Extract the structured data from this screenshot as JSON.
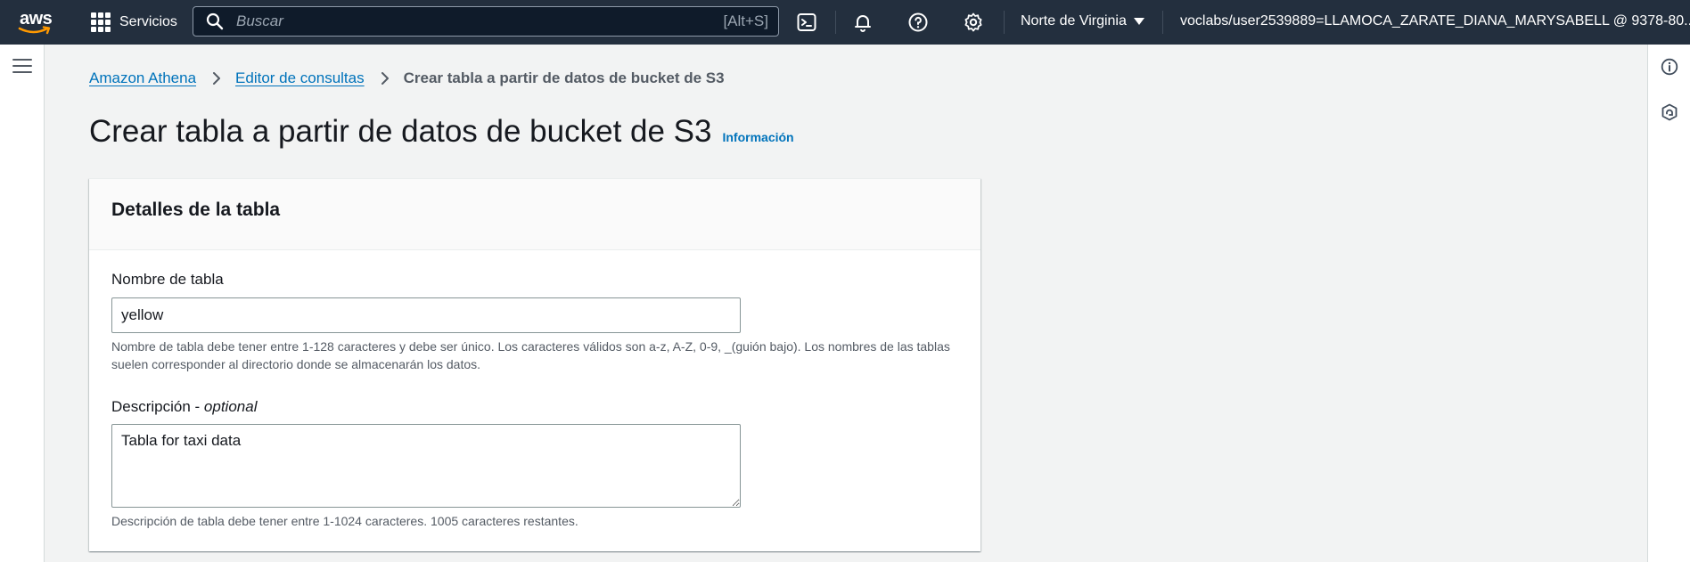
{
  "topnav": {
    "logo_text": "aws",
    "services_label": "Servicios",
    "search_placeholder": "Buscar",
    "search_shortcut": "[Alt+S]",
    "region_label": "Norte de Virginia",
    "user_label": "voclabs/user2539889=LLAMOCA_ZARATE_DIANA_MARYSABELL @ 9378-80..."
  },
  "breadcrumb": {
    "items": [
      "Amazon Athena",
      "Editor de consultas"
    ],
    "current": "Crear tabla a partir de datos de bucket de S3"
  },
  "page": {
    "title": "Crear tabla a partir de datos de bucket de S3",
    "info_link": "Información"
  },
  "panel": {
    "title": "Detalles de la tabla",
    "table_name": {
      "label": "Nombre de tabla",
      "value": "yellow",
      "hint": "Nombre de tabla debe tener entre 1-128 caracteres y debe ser único. Los caracteres válidos son a-z, A-Z, 0-9, _(guión bajo). Los nombres de las tablas suelen corresponder al directorio donde se almacenarán los datos."
    },
    "description": {
      "label": "Descripción",
      "optional": "optional",
      "value": "Tabla for taxi data",
      "hint": "Descripción de tabla debe tener entre 1-1024 caracteres. 1005 caracteres restantes."
    }
  },
  "colors": {
    "nav_bg": "#232f3e",
    "link": "#0073bb",
    "page_bg": "#f2f3f3"
  }
}
